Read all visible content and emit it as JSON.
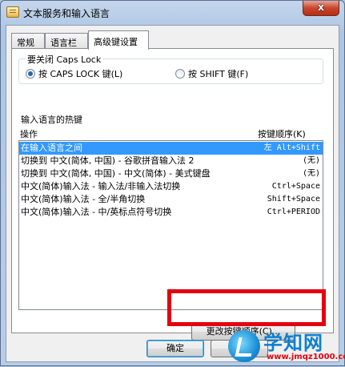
{
  "window": {
    "title": "文本服务和输入语言",
    "close_label": "x"
  },
  "tabs": [
    {
      "label": "常规"
    },
    {
      "label": "语言栏"
    },
    {
      "label": "高级键设置"
    }
  ],
  "caps_lock": {
    "group_label": "要关闭 Caps Lock",
    "option_caps": "按 CAPS LOCK 键(L)",
    "option_shift": "按 SHIFT 键(F)",
    "selected": "caps"
  },
  "hotkeys": {
    "group_label": "输入语言的热键",
    "col_action": "操作",
    "col_key": "按键顺序(K)",
    "rows": [
      {
        "action": "在输入语言之间",
        "key": "左 Alt+Shift",
        "selected": true
      },
      {
        "action": "切换到 中文(简体, 中国) - 谷歌拼音输入法 2",
        "key": "(无)",
        "selected": false
      },
      {
        "action": "切换到 中文(简体, 中国) - 中文(简体) - 美式键盘",
        "key": "(无)",
        "selected": false
      },
      {
        "action": "中文(简体)输入法 - 输入法/非输入法切换",
        "key": "Ctrl+Space",
        "selected": false
      },
      {
        "action": "中文(简体)输入法 - 全/半角切换",
        "key": "Shift+Space",
        "selected": false
      },
      {
        "action": "中文(简体)输入法 - 中/英标点符号切换",
        "key": "Ctrl+PERIOD",
        "selected": false
      }
    ],
    "change_button": "更改按键顺序(C)..."
  },
  "footer": {
    "ok_label": "确定"
  },
  "watermark": {
    "name": "学知网",
    "url": "www.jmqz1000.com"
  },
  "colors": {
    "selection": "#3399ff",
    "highlight_box": "#e3000f"
  }
}
